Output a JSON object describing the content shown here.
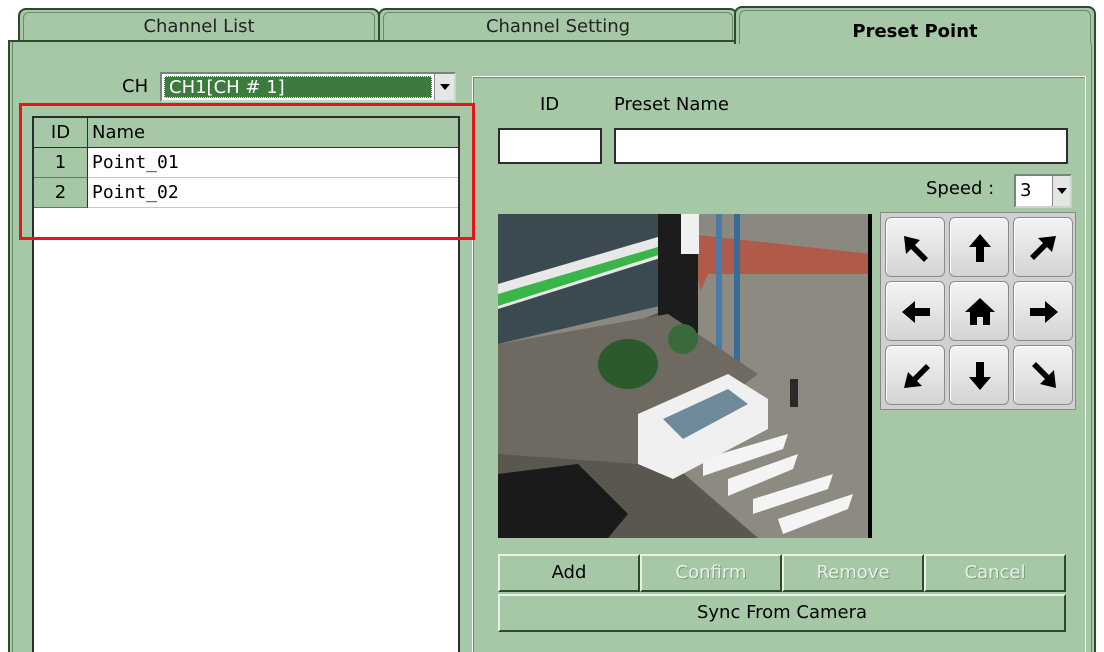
{
  "tabs": [
    {
      "label": "Channel List"
    },
    {
      "label": "Channel Setting"
    },
    {
      "label": "Preset Point"
    }
  ],
  "channel": {
    "label": "CH",
    "selected": "CH1[CH # 1]"
  },
  "preset_list": {
    "headers": {
      "id": "ID",
      "name": "Name"
    },
    "rows": [
      {
        "id": "1",
        "name": "Point_01"
      },
      {
        "id": "2",
        "name": "Point_02"
      }
    ]
  },
  "form": {
    "id_label": "ID",
    "name_label": "Preset Name",
    "id_value": "",
    "name_value": "",
    "speed_label": "Speed :",
    "speed_value": "3"
  },
  "ptz_icons": [
    "up-left-arrow-icon",
    "up-arrow-icon",
    "up-right-arrow-icon",
    "left-arrow-icon",
    "home-icon",
    "right-arrow-icon",
    "down-left-arrow-icon",
    "down-arrow-icon",
    "down-right-arrow-icon"
  ],
  "buttons": {
    "add": "Add",
    "confirm": "Confirm",
    "remove": "Remove",
    "cancel": "Cancel",
    "sync": "Sync From Camera"
  },
  "colors": {
    "panel": "#a6c8a6",
    "selection": "#3d7a3d",
    "highlight": "#e8141c"
  }
}
